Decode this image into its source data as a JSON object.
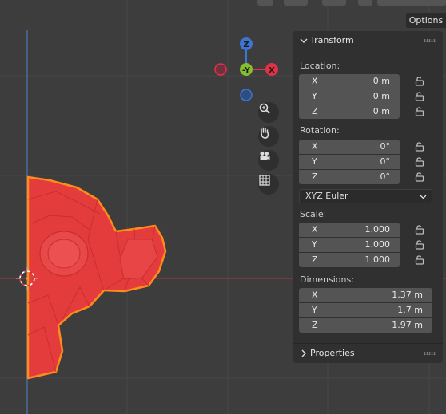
{
  "header": {
    "options_label": "Options"
  },
  "gizmo": {
    "z_label": "Z",
    "y_label": "-Y",
    "x_label": "X",
    "z_color": "#3d75d1",
    "y_color": "#84bf2f",
    "x_color": "#e03246"
  },
  "nav_tools": [
    {
      "icon": "zoom-icon"
    },
    {
      "icon": "hand-pan-icon"
    },
    {
      "icon": "camera-icon"
    },
    {
      "icon": "grid-icon"
    }
  ],
  "transform": {
    "title": "Transform",
    "location_label": "Location:",
    "location": [
      {
        "axis": "X",
        "value": "0 m"
      },
      {
        "axis": "Y",
        "value": "0 m"
      },
      {
        "axis": "Z",
        "value": "0 m"
      }
    ],
    "rotation_label": "Rotation:",
    "rotation": [
      {
        "axis": "X",
        "value": "0°"
      },
      {
        "axis": "Y",
        "value": "0°"
      },
      {
        "axis": "Z",
        "value": "0°"
      }
    ],
    "rotation_mode": "XYZ Euler",
    "scale_label": "Scale:",
    "scale": [
      {
        "axis": "X",
        "value": "1.000"
      },
      {
        "axis": "Y",
        "value": "1.000"
      },
      {
        "axis": "Z",
        "value": "1.000"
      }
    ],
    "dimensions_label": "Dimensions:",
    "dimensions": [
      {
        "axis": "X",
        "value": "1.37 m"
      },
      {
        "axis": "Y",
        "value": "1.7 m"
      },
      {
        "axis": "Z",
        "value": "1.97 m"
      }
    ]
  },
  "properties": {
    "title": "Properties"
  },
  "colors": {
    "viewport_bg": "#3d3d3d",
    "panel_bg": "#303030",
    "field_bg": "#545454",
    "selection_outline": "#ff8c1a",
    "mesh_fill": "#e43c3c",
    "x_axis_line": "#a83a44",
    "y_axis_line": "#4a78b8"
  }
}
